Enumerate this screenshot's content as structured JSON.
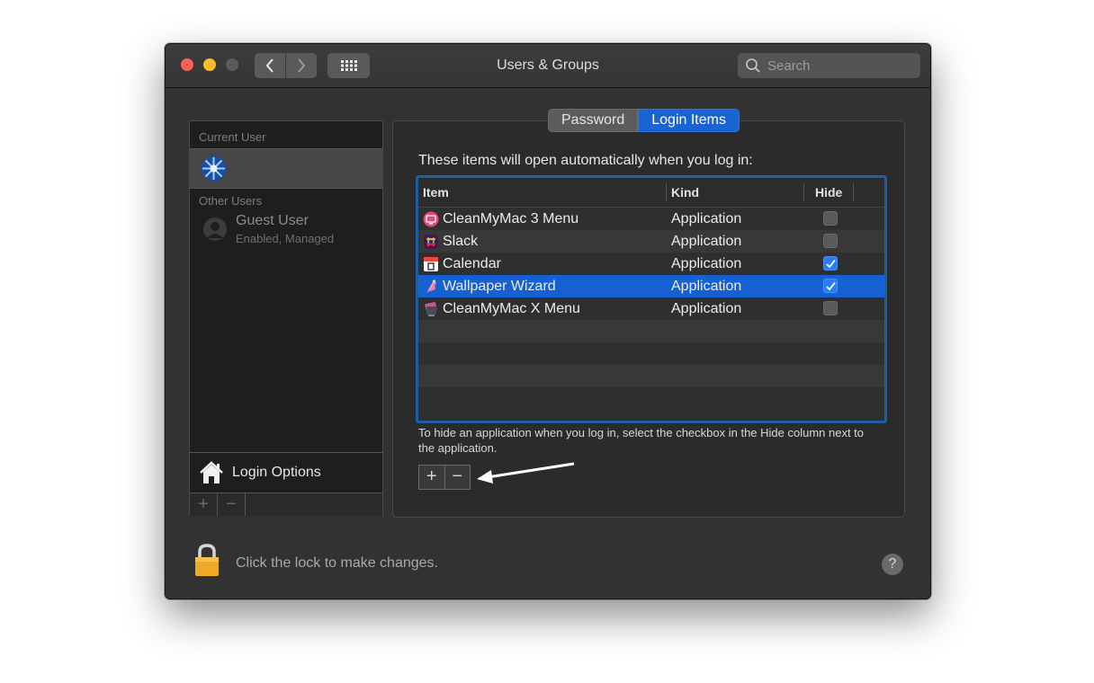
{
  "window": {
    "title": "Users & Groups"
  },
  "search": {
    "placeholder": "Search"
  },
  "sidebar": {
    "current_user_label": "Current User",
    "other_users_label": "Other Users",
    "guest": {
      "name": "Guest User",
      "status": "Enabled, Managed"
    },
    "login_options": "Login Options",
    "add_symbol": "+",
    "remove_symbol": "−"
  },
  "tabs": [
    {
      "label": "Password",
      "active": false
    },
    {
      "label": "Login Items",
      "active": true
    }
  ],
  "login_items": {
    "intro": "These items will open automatically when you log in:",
    "columns": {
      "item": "Item",
      "kind": "Kind",
      "hide": "Hide"
    },
    "rows": [
      {
        "name": "CleanMyMac 3 Menu",
        "kind": "Application",
        "hide": false,
        "icon": "cleanmymac3-icon"
      },
      {
        "name": "Slack",
        "kind": "Application",
        "hide": false,
        "icon": "slack-icon"
      },
      {
        "name": "Calendar",
        "kind": "Application",
        "hide": true,
        "icon": "calendar-icon"
      },
      {
        "name": "Wallpaper Wizard",
        "kind": "Application",
        "hide": true,
        "icon": "wallpaper-wizard-icon",
        "selected": true
      },
      {
        "name": "CleanMyMac X Menu",
        "kind": "Application",
        "hide": false,
        "icon": "cleanmymacx-icon"
      }
    ],
    "help": "To hide an application when you log in, select the checkbox in the Hide column next to the application.",
    "add_symbol": "+",
    "remove_symbol": "−"
  },
  "footer": {
    "lock_text": "Click the lock to make changes.",
    "help_symbol": "?"
  },
  "colors": {
    "accent": "#1561d4",
    "checkbox_on": "#2a7df6",
    "window_bg": "#323232"
  }
}
